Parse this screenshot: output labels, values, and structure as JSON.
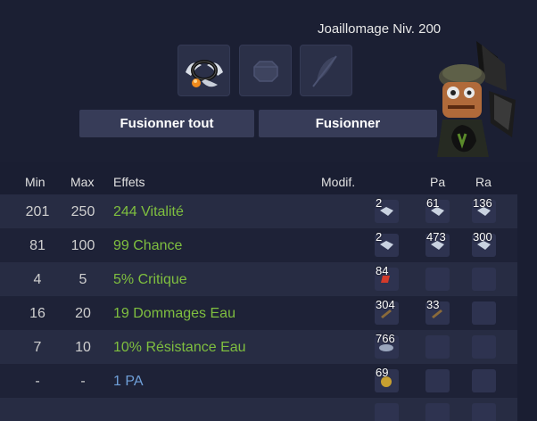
{
  "header": {
    "job_title": "Joaillomage Niv. 200"
  },
  "slots": [
    {
      "icon": "winged-ring-icon"
    },
    {
      "icon": "rune-stone-icon"
    },
    {
      "icon": "feather-icon"
    }
  ],
  "buttons": {
    "merge_all": "Fusionner tout",
    "merge": "Fusionner"
  },
  "columns": {
    "min": "Min",
    "max": "Max",
    "effects": "Effets",
    "modif": "Modif.",
    "pa": "Pa",
    "ra": "Ra"
  },
  "rows": [
    {
      "min": "201",
      "max": "250",
      "effect": "244 Vitalité",
      "color": "#7fbf3f",
      "modif": "2",
      "pa": "61",
      "ra": "136"
    },
    {
      "min": "81",
      "max": "100",
      "effect": "99 Chance",
      "color": "#7fbf3f",
      "modif": "2",
      "pa": "473",
      "ra": "300"
    },
    {
      "min": "4",
      "max": "5",
      "effect": "5% Critique",
      "color": "#7fbf3f",
      "modif": "84",
      "pa": "",
      "ra": ""
    },
    {
      "min": "16",
      "max": "20",
      "effect": "19 Dommages Eau",
      "color": "#7fbf3f",
      "modif": "304",
      "pa": "33",
      "ra": ""
    },
    {
      "min": "7",
      "max": "10",
      "effect": "10% Résistance Eau",
      "color": "#7fbf3f",
      "modif": "766",
      "pa": "",
      "ra": ""
    },
    {
      "min": "-",
      "max": "-",
      "effect": "1 PA",
      "color": "#6f9fd8",
      "modif": "69",
      "pa": "",
      "ra": ""
    },
    {
      "min": "",
      "max": "",
      "effect": "",
      "color": "#7fbf3f",
      "modif": "",
      "pa": "",
      "ra": ""
    }
  ]
}
